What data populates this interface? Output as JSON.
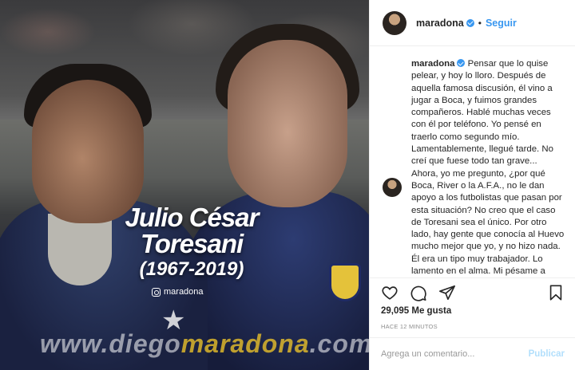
{
  "post": {
    "username": "maradona",
    "follow_label": "Seguir",
    "separator": "•",
    "caption": "Pensar que lo quise pelear, y hoy lo lloro. Después de aquella famosa discusión, él vino a jugar a Boca, y fuimos grandes compañeros. Hablé muchas veces con él por teléfono. Yo pensé en traerlo como segundo mío. Lamentablemente, llegué tarde. No creí que fuese todo tan grave... Ahora, yo me pregunto, ¿por qué Boca, River o la A.F.A., no le dan apoyo a los futbolistas que pasan por esta situación? No creo que el caso de Toresani sea el único. Por otro lado, hay gente que conocía al Huevo mucho mejor que yo, y no hizo nada. Él era un tipo muy trabajador. Lo lamento en el alma. Mi pésame a toda su familia. Ojalá que los hijos tengan el mismo corazón que su padre.",
    "likes": "29,095 Me gusta",
    "time_ago": "Hace 12 minutos",
    "comment_placeholder": "Agrega un comentario...",
    "publish_label": "Publicar"
  },
  "image": {
    "title_line1": "Julio César",
    "title_line2": "Toresani",
    "title_years": "(1967-2019)",
    "ig_handle": "maradona",
    "watermark_a": "www.diego",
    "watermark_b": "maradona",
    "watermark_c": ".com"
  },
  "icons": {
    "like": "heart-icon",
    "comment": "comment-icon",
    "share": "share-icon",
    "save": "bookmark-icon",
    "verified": "verified-badge-icon"
  },
  "colors": {
    "link_blue": "#3897f0",
    "publish_disabled": "#b2dffc",
    "muted": "#8e8e8e"
  }
}
